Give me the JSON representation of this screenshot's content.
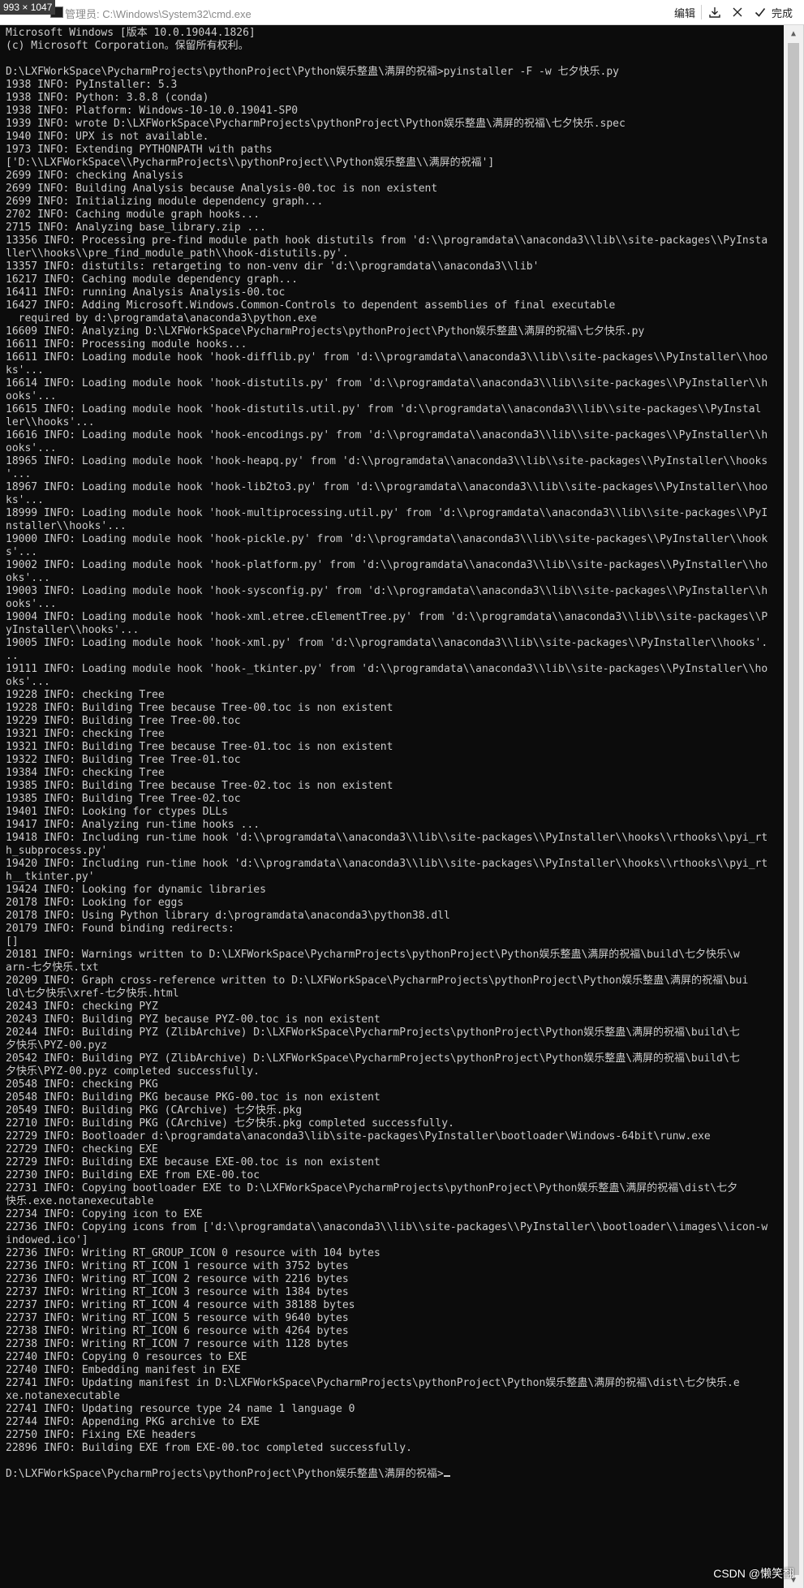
{
  "screenshot_badge": "993 × 1047",
  "window": {
    "title": "管理员: C:\\Windows\\System32\\cmd.exe"
  },
  "toolbar": {
    "edit_label": "编辑",
    "download_icon": "download-icon",
    "close_icon": "close-icon",
    "done_label": "完成"
  },
  "console": {
    "text": "Microsoft Windows [版本 10.0.19044.1826]\n(c) Microsoft Corporation。保留所有权利。\n\nD:\\LXFWorkSpace\\PycharmProjects\\pythonProject\\Python娱乐整蛊\\满屏的祝福>pyinstaller -F -w 七夕快乐.py\n1938 INFO: PyInstaller: 5.3\n1938 INFO: Python: 3.8.8 (conda)\n1938 INFO: Platform: Windows-10-10.0.19041-SP0\n1939 INFO: wrote D:\\LXFWorkSpace\\PycharmProjects\\pythonProject\\Python娱乐整蛊\\满屏的祝福\\七夕快乐.spec\n1940 INFO: UPX is not available.\n1973 INFO: Extending PYTHONPATH with paths\n['D:\\\\LXFWorkSpace\\\\PycharmProjects\\\\pythonProject\\\\Python娱乐整蛊\\\\满屏的祝福']\n2699 INFO: checking Analysis\n2699 INFO: Building Analysis because Analysis-00.toc is non existent\n2699 INFO: Initializing module dependency graph...\n2702 INFO: Caching module graph hooks...\n2715 INFO: Analyzing base_library.zip ...\n13356 INFO: Processing pre-find module path hook distutils from 'd:\\\\programdata\\\\anaconda3\\\\lib\\\\site-packages\\\\PyInsta\nller\\\\hooks\\\\pre_find_module_path\\\\hook-distutils.py'.\n13357 INFO: distutils: retargeting to non-venv dir 'd:\\\\programdata\\\\anaconda3\\\\lib'\n16217 INFO: Caching module dependency graph...\n16411 INFO: running Analysis Analysis-00.toc\n16427 INFO: Adding Microsoft.Windows.Common-Controls to dependent assemblies of final executable\n  required by d:\\programdata\\anaconda3\\python.exe\n16609 INFO: Analyzing D:\\LXFWorkSpace\\PycharmProjects\\pythonProject\\Python娱乐整蛊\\满屏的祝福\\七夕快乐.py\n16611 INFO: Processing module hooks...\n16611 INFO: Loading module hook 'hook-difflib.py' from 'd:\\\\programdata\\\\anaconda3\\\\lib\\\\site-packages\\\\PyInstaller\\\\hoo\nks'...\n16614 INFO: Loading module hook 'hook-distutils.py' from 'd:\\\\programdata\\\\anaconda3\\\\lib\\\\site-packages\\\\PyInstaller\\\\h\nooks'...\n16615 INFO: Loading module hook 'hook-distutils.util.py' from 'd:\\\\programdata\\\\anaconda3\\\\lib\\\\site-packages\\\\PyInstal\nler\\\\hooks'...\n16616 INFO: Loading module hook 'hook-encodings.py' from 'd:\\\\programdata\\\\anaconda3\\\\lib\\\\site-packages\\\\PyInstaller\\\\h\nooks'...\n18965 INFO: Loading module hook 'hook-heapq.py' from 'd:\\\\programdata\\\\anaconda3\\\\lib\\\\site-packages\\\\PyInstaller\\\\hooks\n'...\n18967 INFO: Loading module hook 'hook-lib2to3.py' from 'd:\\\\programdata\\\\anaconda3\\\\lib\\\\site-packages\\\\PyInstaller\\\\hoo\nks'...\n18999 INFO: Loading module hook 'hook-multiprocessing.util.py' from 'd:\\\\programdata\\\\anaconda3\\\\lib\\\\site-packages\\\\PyI\nnstaller\\\\hooks'...\n19000 INFO: Loading module hook 'hook-pickle.py' from 'd:\\\\programdata\\\\anaconda3\\\\lib\\\\site-packages\\\\PyInstaller\\\\hook\ns'...\n19002 INFO: Loading module hook 'hook-platform.py' from 'd:\\\\programdata\\\\anaconda3\\\\lib\\\\site-packages\\\\PyInstaller\\\\ho\noks'...\n19003 INFO: Loading module hook 'hook-sysconfig.py' from 'd:\\\\programdata\\\\anaconda3\\\\lib\\\\site-packages\\\\PyInstaller\\\\h\nooks'...\n19004 INFO: Loading module hook 'hook-xml.etree.cElementTree.py' from 'd:\\\\programdata\\\\anaconda3\\\\lib\\\\site-packages\\\\P\nyInstaller\\\\hooks'...\n19005 INFO: Loading module hook 'hook-xml.py' from 'd:\\\\programdata\\\\anaconda3\\\\lib\\\\site-packages\\\\PyInstaller\\\\hooks'.\n..\n19111 INFO: Loading module hook 'hook-_tkinter.py' from 'd:\\\\programdata\\\\anaconda3\\\\lib\\\\site-packages\\\\PyInstaller\\\\ho\noks'...\n19228 INFO: checking Tree\n19228 INFO: Building Tree because Tree-00.toc is non existent\n19229 INFO: Building Tree Tree-00.toc\n19321 INFO: checking Tree\n19321 INFO: Building Tree because Tree-01.toc is non existent\n19322 INFO: Building Tree Tree-01.toc\n19384 INFO: checking Tree\n19385 INFO: Building Tree because Tree-02.toc is non existent\n19385 INFO: Building Tree Tree-02.toc\n19401 INFO: Looking for ctypes DLLs\n19417 INFO: Analyzing run-time hooks ...\n19418 INFO: Including run-time hook 'd:\\\\programdata\\\\anaconda3\\\\lib\\\\site-packages\\\\PyInstaller\\\\hooks\\\\rthooks\\\\pyi_rt\nh_subprocess.py'\n19420 INFO: Including run-time hook 'd:\\\\programdata\\\\anaconda3\\\\lib\\\\site-packages\\\\PyInstaller\\\\hooks\\\\rthooks\\\\pyi_rt\nh__tkinter.py'\n19424 INFO: Looking for dynamic libraries\n20178 INFO: Looking for eggs\n20178 INFO: Using Python library d:\\programdata\\anaconda3\\python38.dll\n20179 INFO: Found binding redirects:\n[]\n20181 INFO: Warnings written to D:\\LXFWorkSpace\\PycharmProjects\\pythonProject\\Python娱乐整蛊\\满屏的祝福\\build\\七夕快乐\\w\narn-七夕快乐.txt\n20209 INFO: Graph cross-reference written to D:\\LXFWorkSpace\\PycharmProjects\\pythonProject\\Python娱乐整蛊\\满屏的祝福\\bui\nld\\七夕快乐\\xref-七夕快乐.html\n20243 INFO: checking PYZ\n20243 INFO: Building PYZ because PYZ-00.toc is non existent\n20244 INFO: Building PYZ (ZlibArchive) D:\\LXFWorkSpace\\PycharmProjects\\pythonProject\\Python娱乐整蛊\\满屏的祝福\\build\\七\n夕快乐\\PYZ-00.pyz\n20542 INFO: Building PYZ (ZlibArchive) D:\\LXFWorkSpace\\PycharmProjects\\pythonProject\\Python娱乐整蛊\\满屏的祝福\\build\\七\n夕快乐\\PYZ-00.pyz completed successfully.\n20548 INFO: checking PKG\n20548 INFO: Building PKG because PKG-00.toc is non existent\n20549 INFO: Building PKG (CArchive) 七夕快乐.pkg\n22710 INFO: Building PKG (CArchive) 七夕快乐.pkg completed successfully.\n22729 INFO: Bootloader d:\\programdata\\anaconda3\\lib\\site-packages\\PyInstaller\\bootloader\\Windows-64bit\\runw.exe\n22729 INFO: checking EXE\n22729 INFO: Building EXE because EXE-00.toc is non existent\n22730 INFO: Building EXE from EXE-00.toc\n22731 INFO: Copying bootloader EXE to D:\\LXFWorkSpace\\PycharmProjects\\pythonProject\\Python娱乐整蛊\\满屏的祝福\\dist\\七夕\n快乐.exe.notanexecutable\n22734 INFO: Copying icon to EXE\n22736 INFO: Copying icons from ['d:\\\\programdata\\\\anaconda3\\\\lib\\\\site-packages\\\\PyInstaller\\\\bootloader\\\\images\\\\icon-w\nindowed.ico']\n22736 INFO: Writing RT_GROUP_ICON 0 resource with 104 bytes\n22736 INFO: Writing RT_ICON 1 resource with 3752 bytes\n22736 INFO: Writing RT_ICON 2 resource with 2216 bytes\n22737 INFO: Writing RT_ICON 3 resource with 1384 bytes\n22737 INFO: Writing RT_ICON 4 resource with 38188 bytes\n22737 INFO: Writing RT_ICON 5 resource with 9640 bytes\n22738 INFO: Writing RT_ICON 6 resource with 4264 bytes\n22738 INFO: Writing RT_ICON 7 resource with 1128 bytes\n22740 INFO: Copying 0 resources to EXE\n22740 INFO: Embedding manifest in EXE\n22741 INFO: Updating manifest in D:\\LXFWorkSpace\\PycharmProjects\\pythonProject\\Python娱乐整蛊\\满屏的祝福\\dist\\七夕快乐.e\nxe.notanexecutable\n22741 INFO: Updating resource type 24 name 1 language 0\n22744 INFO: Appending PKG archive to EXE\n22750 INFO: Fixing EXE headers\n22896 INFO: Building EXE from EXE-00.toc completed successfully.\n\nD:\\LXFWorkSpace\\PycharmProjects\\pythonProject\\Python娱乐整蛊\\满屏的祝福>"
  },
  "watermark": "CSDN @懒笑翻",
  "colors": {
    "console_bg": "#0c0c0c",
    "console_fg": "#cccccc"
  }
}
